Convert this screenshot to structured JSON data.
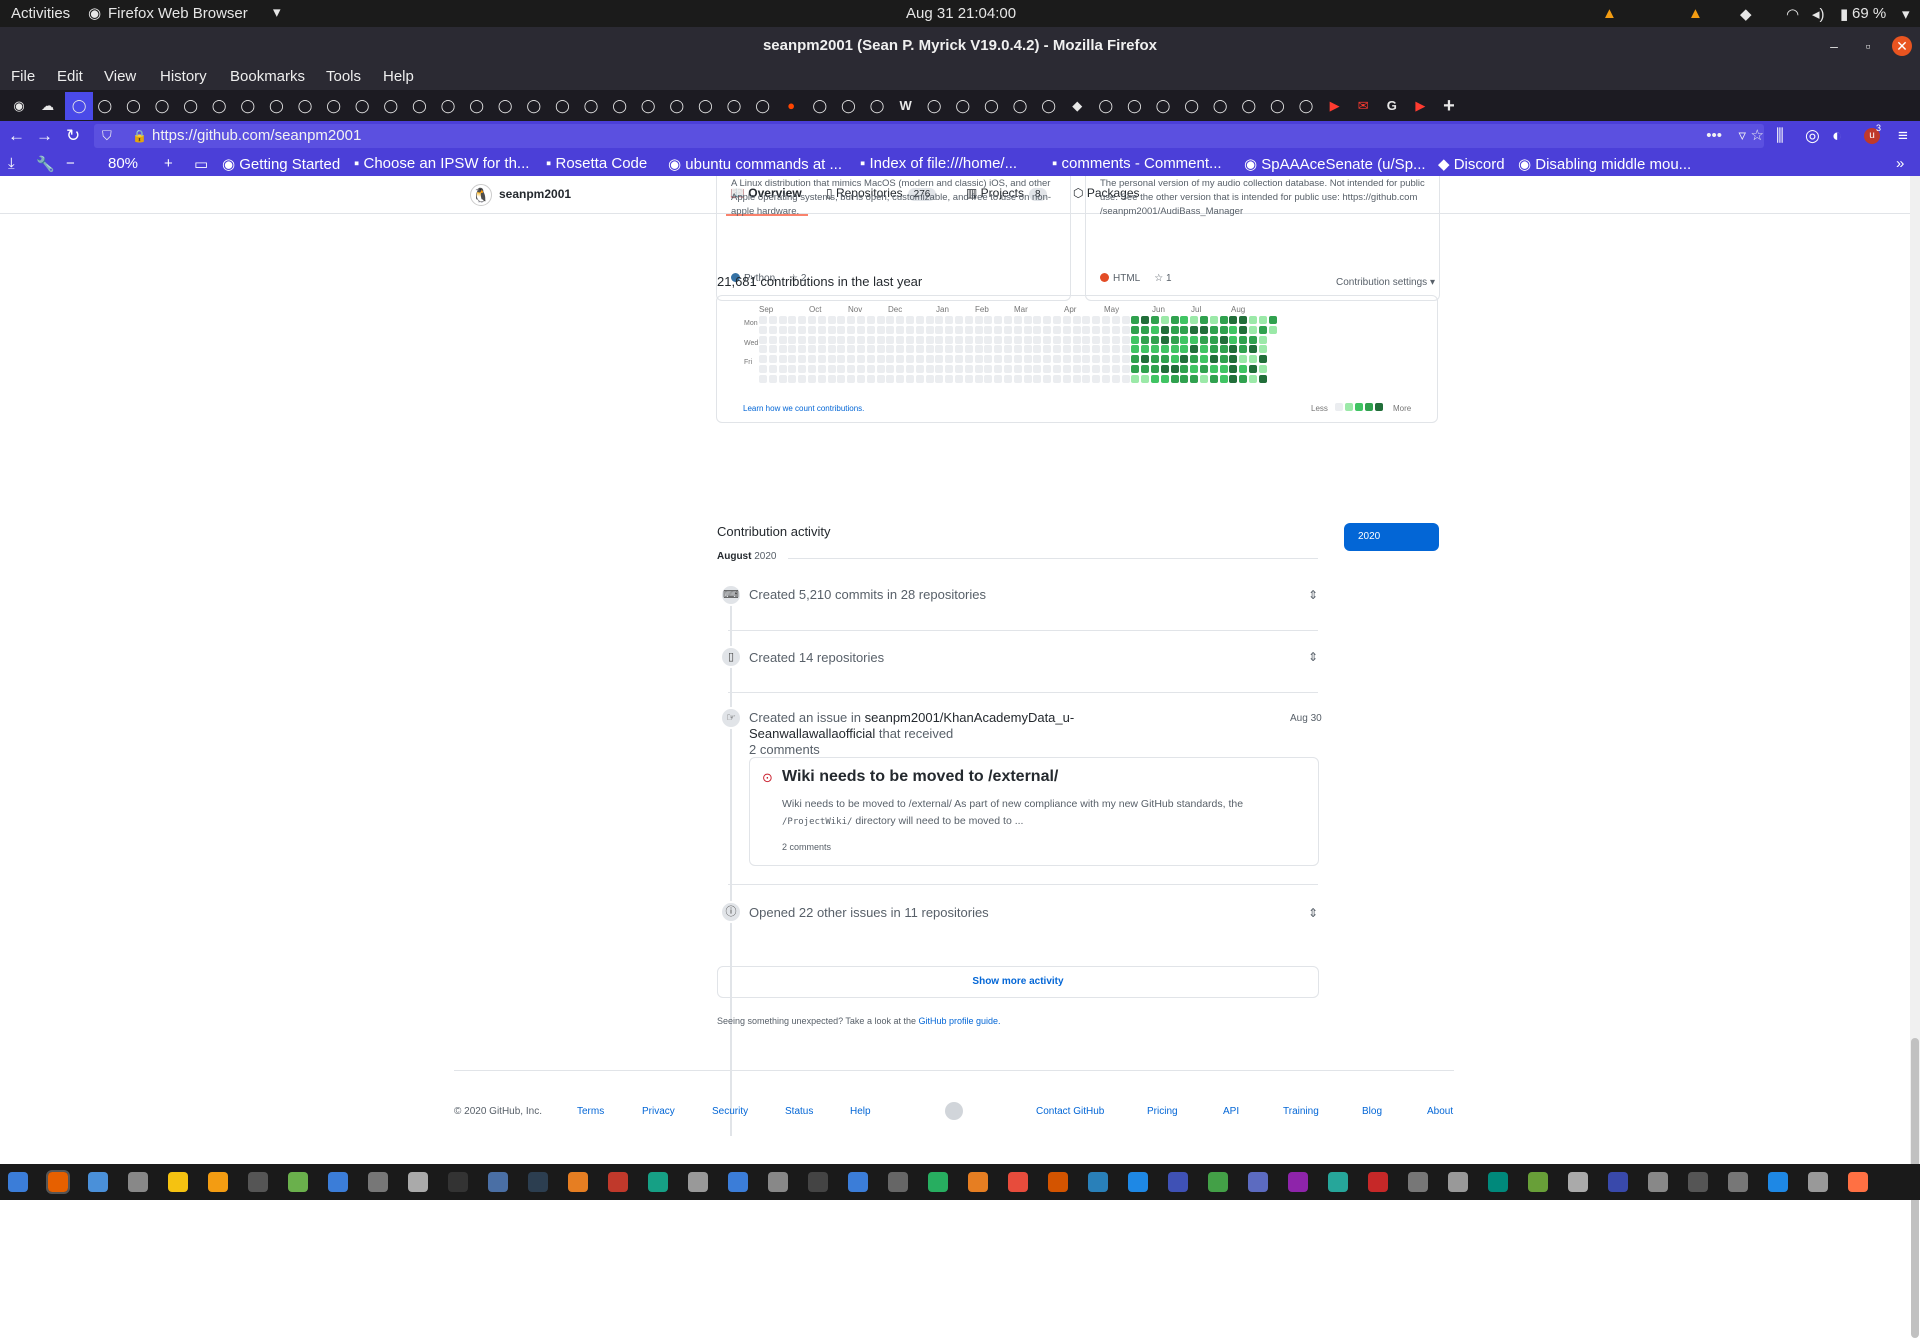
{
  "system": {
    "activities": "Activities",
    "app_menu": "Firefox Web Browser",
    "clock": "Aug 31  21:04:00",
    "battery": "69 %"
  },
  "window": {
    "title": "seanpm2001 (Sean P. Myrick V19.0.4.2) - Mozilla Firefox"
  },
  "menu": [
    "File",
    "Edit",
    "View",
    "History",
    "Bookmarks",
    "Tools",
    "Help"
  ],
  "nav": {
    "url": "https://github.com/seanpm2001",
    "zoom": "80%",
    "ext_badge": "3"
  },
  "bookmarks": [
    "Getting Started",
    "Choose an IPSW for th...",
    "Rosetta Code",
    "ubuntu commands at ...",
    "Index of file:///home/...",
    "comments - Comment...",
    "SpAAAceSenate (u/Sp...",
    "Discord",
    "Disabling middle mou..."
  ],
  "profile": {
    "username": "seanpm2001",
    "tabs": [
      {
        "label": "Overview",
        "count": ""
      },
      {
        "label": "Repositories",
        "count": "276"
      },
      {
        "label": "Projects",
        "count": "8"
      },
      {
        "label": "Packages",
        "count": ""
      }
    ]
  },
  "pinned": [
    {
      "desc": "A Linux distribution that mimics MacOS (modern and classic) iOS, and other Apple operating systems, but is open, customizable, and free to use on non-apple hardware.",
      "lang": "Python",
      "lang_color": "#3572A5",
      "stars": "2"
    },
    {
      "desc": "The personal version of my audio collection database. Not intended for public use. See the other version that is intended for public use: https://github.com /seanpm2001/AudiBass_Manager",
      "lang": "HTML",
      "lang_color": "#e34c26",
      "stars": "1"
    }
  ],
  "contrib": {
    "summary": "21,681 contributions in the last year",
    "settings": "Contribution settings ▾",
    "months": [
      "Sep",
      "Oct",
      "Nov",
      "Dec",
      "Jan",
      "Feb",
      "Mar",
      "Apr",
      "May",
      "Jun",
      "Jul",
      "Aug"
    ],
    "days": [
      "Mon",
      "Wed",
      "Fri"
    ],
    "learn": "Learn how we count contributions.",
    "less": "Less",
    "more": "More",
    "colors": [
      "#ebedf0",
      "#9be9a8",
      "#40c463",
      "#30a14e",
      "#216e39"
    ]
  },
  "activity": {
    "heading": "Contribution activity",
    "year": "2020",
    "month": "August",
    "month_year": "2020",
    "items": [
      {
        "text": "Created 5,210 commits in 28 repositories"
      },
      {
        "text": "Created 14 repositories"
      },
      {
        "pre": "Created an issue in ",
        "repo": "seanpm2001/KhanAcademyData_u-Seanwallawallaofficial",
        "post": " that received",
        "line2": "2 comments",
        "date": "Aug 30"
      },
      {
        "text": "Opened 22 other issues in 11 repositories"
      }
    ],
    "issue": {
      "title": "Wiki needs to be moved to /external/",
      "body1": "Wiki needs to be moved to /external/ As part of new compliance with my new GitHub standards, the",
      "code": "/ProjectWiki/",
      "body2": " directory will need to be moved to ...",
      "comments": "2 comments"
    },
    "show_more": "Show more activity",
    "unexpected": "Seeing something unexpected? Take a look at the ",
    "guide": "GitHub profile guide."
  },
  "footer": {
    "copy": "© 2020 GitHub, Inc.",
    "links_left": [
      "Terms",
      "Privacy",
      "Security",
      "Status",
      "Help"
    ],
    "links_right": [
      "Contact GitHub",
      "Pricing",
      "API",
      "Training",
      "Blog",
      "About"
    ]
  }
}
